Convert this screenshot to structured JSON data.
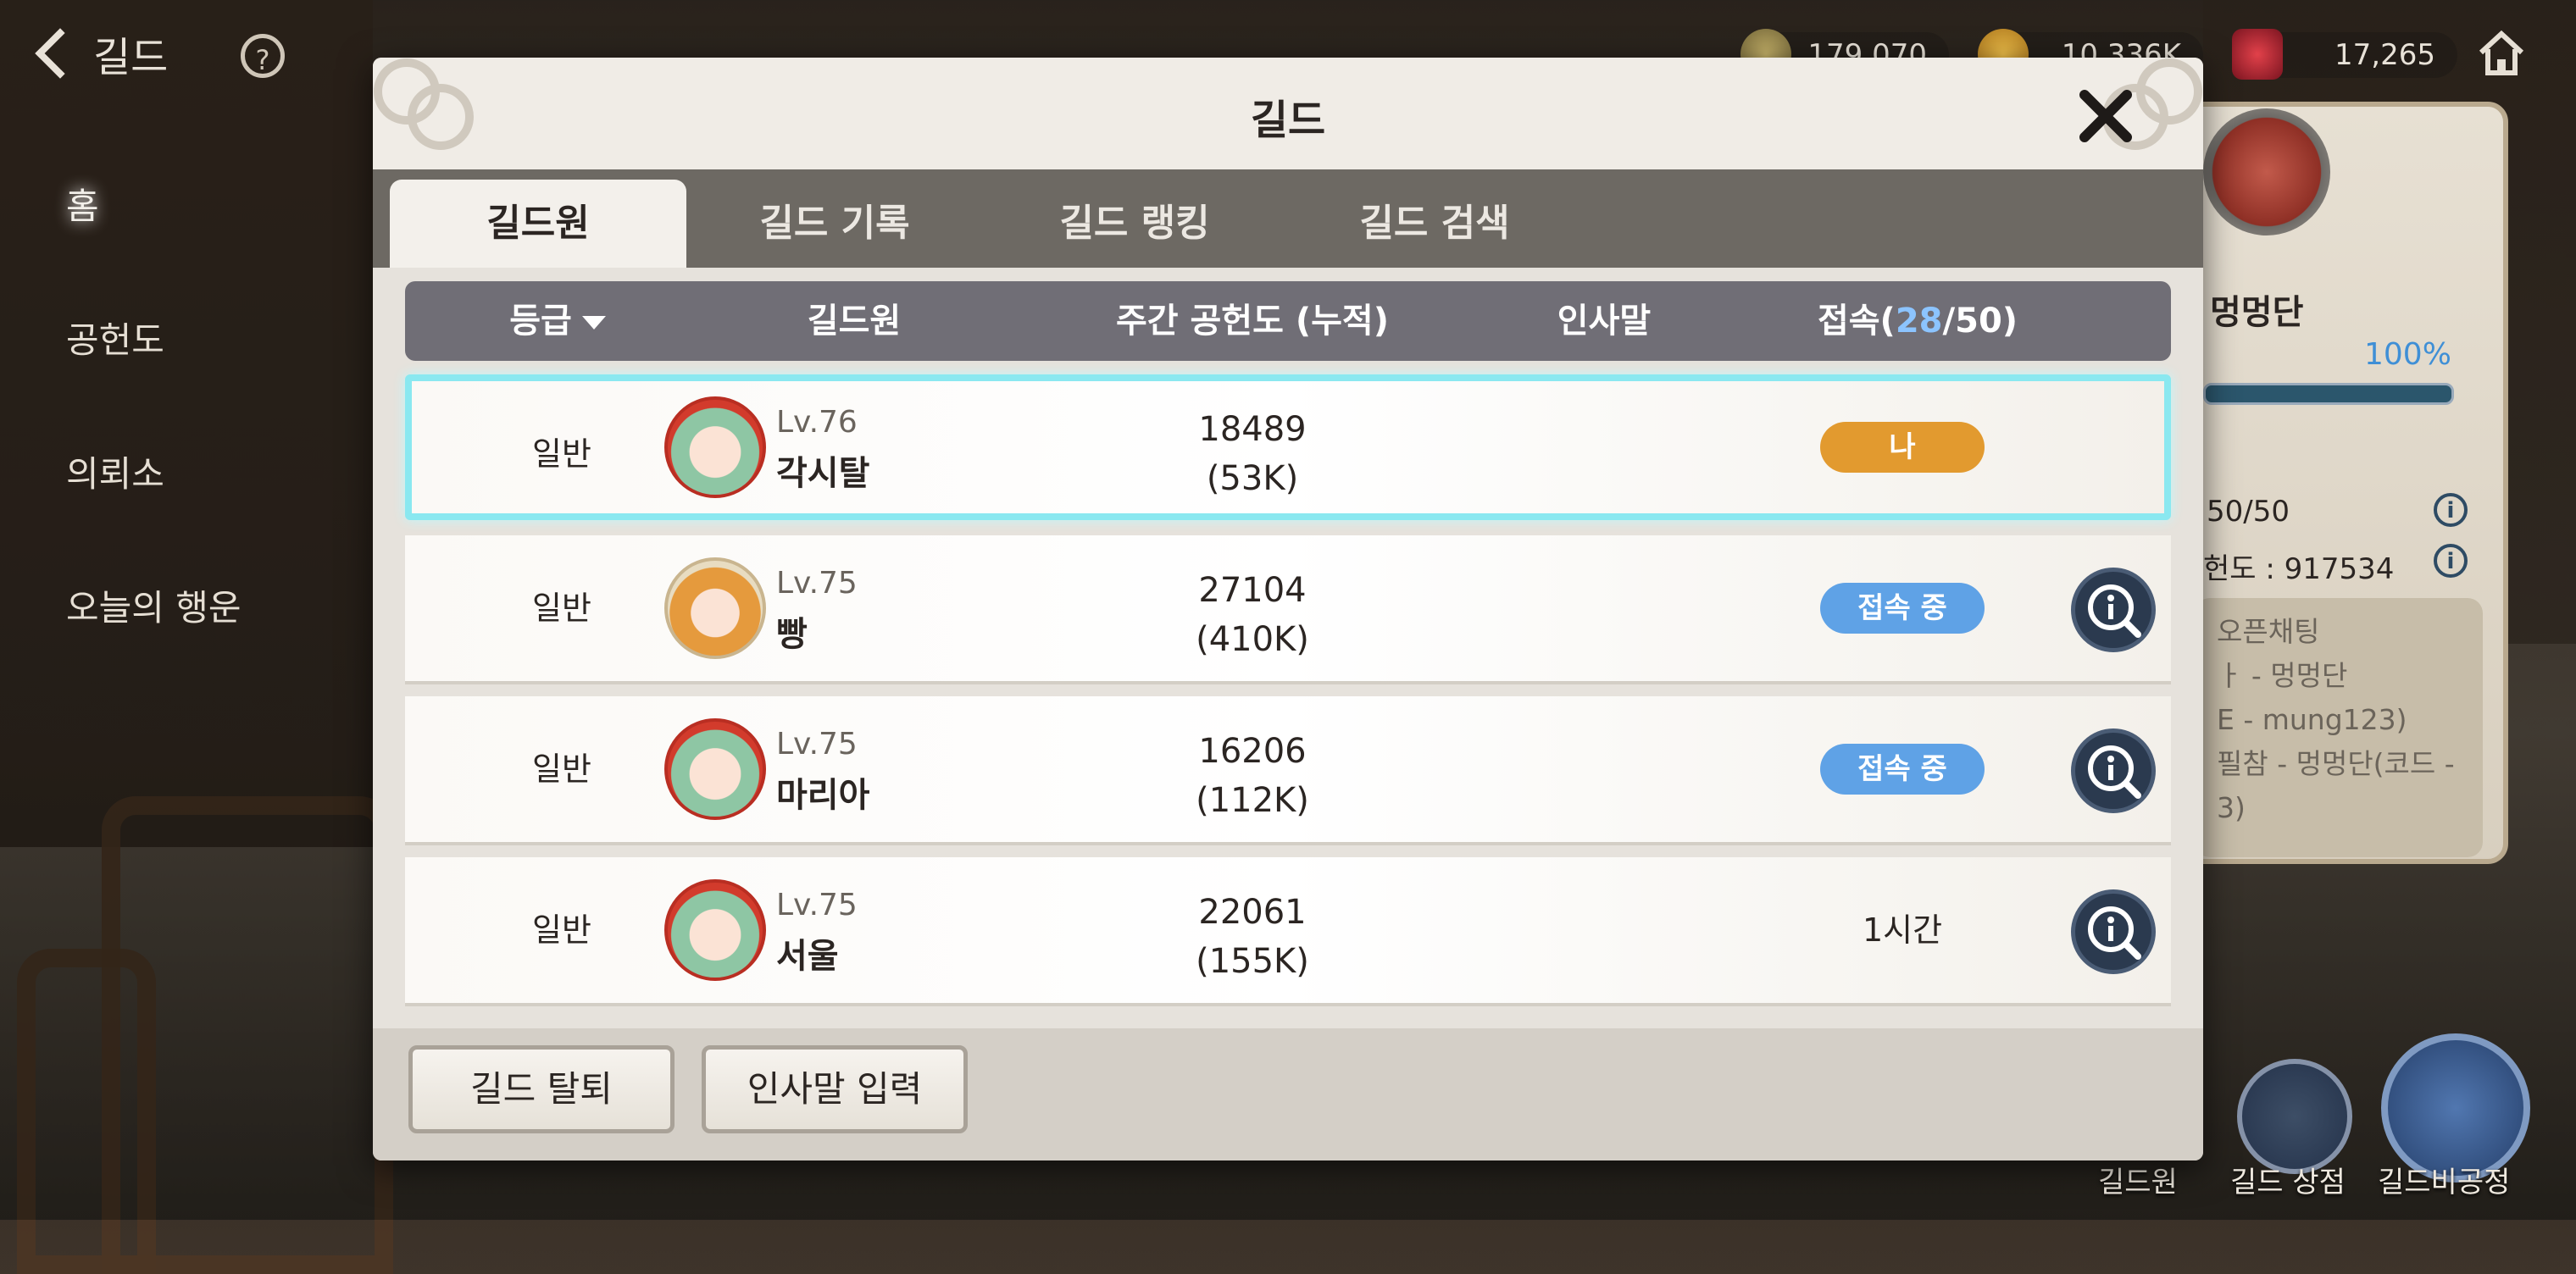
{
  "topbar": {
    "back_label": "길드",
    "help_icon": "?",
    "currencies": [
      {
        "icon": "gem-icon",
        "value": "179,070"
      },
      {
        "icon": "gold-coin-icon",
        "value": "10,336K"
      },
      {
        "icon": "red-crystal-icon",
        "value": "17,265"
      }
    ]
  },
  "side_menu": {
    "items": [
      {
        "label": "홈"
      },
      {
        "label": "공헌도"
      },
      {
        "label": "의뢰소"
      },
      {
        "label": "오늘의 행운"
      }
    ]
  },
  "guild_panel": {
    "name": "멍멍단",
    "progress_text": "100%",
    "progress": 1.0,
    "members": "50/50",
    "contribution": "헌도 : 917534",
    "notice_lines": [
      "오픈채팅",
      "ㅏ - 멍멍단",
      "E - mung123)",
      "필참 - 멍멍단(코드 -",
      "3)"
    ]
  },
  "modal": {
    "title": "길드",
    "tabs": [
      {
        "label": "길드원",
        "active": true
      },
      {
        "label": "길드 기록",
        "active": false
      },
      {
        "label": "길드 랭킹",
        "active": false
      },
      {
        "label": "길드 검색",
        "active": false
      }
    ],
    "table_header": {
      "rank": "등급",
      "member": "길드원",
      "weekly": "주간 공헌도 (누적)",
      "greeting": "인사말",
      "online_prefix": "접속(",
      "online_count": "28",
      "online_suffix": "/50)"
    },
    "rows": [
      {
        "rank": "일반",
        "level": "Lv.76",
        "name": "각시탈",
        "weekly": "18489",
        "total": "(53K)",
        "status": "나",
        "status_type": "me",
        "is_self": true
      },
      {
        "rank": "일반",
        "level": "Lv.75",
        "name": "빵",
        "weekly": "27104",
        "total": "(410K)",
        "status": "접속 중",
        "status_type": "online",
        "is_self": false
      },
      {
        "rank": "일반",
        "level": "Lv.75",
        "name": "마리아",
        "weekly": "16206",
        "total": "(112K)",
        "status": "접속 중",
        "status_type": "online",
        "is_self": false
      },
      {
        "rank": "일반",
        "level": "Lv.75",
        "name": "서울",
        "weekly": "22061",
        "total": "(155K)",
        "status": "1시간",
        "status_type": "text",
        "is_self": false
      }
    ],
    "footer": {
      "leave_label": "길드 탈퇴",
      "greeting_label": "인사말 입력"
    }
  },
  "bottom_nav": {
    "members_label": "길드원",
    "shop_label": "길드 상점",
    "workshop_label": "길드비공정"
  }
}
